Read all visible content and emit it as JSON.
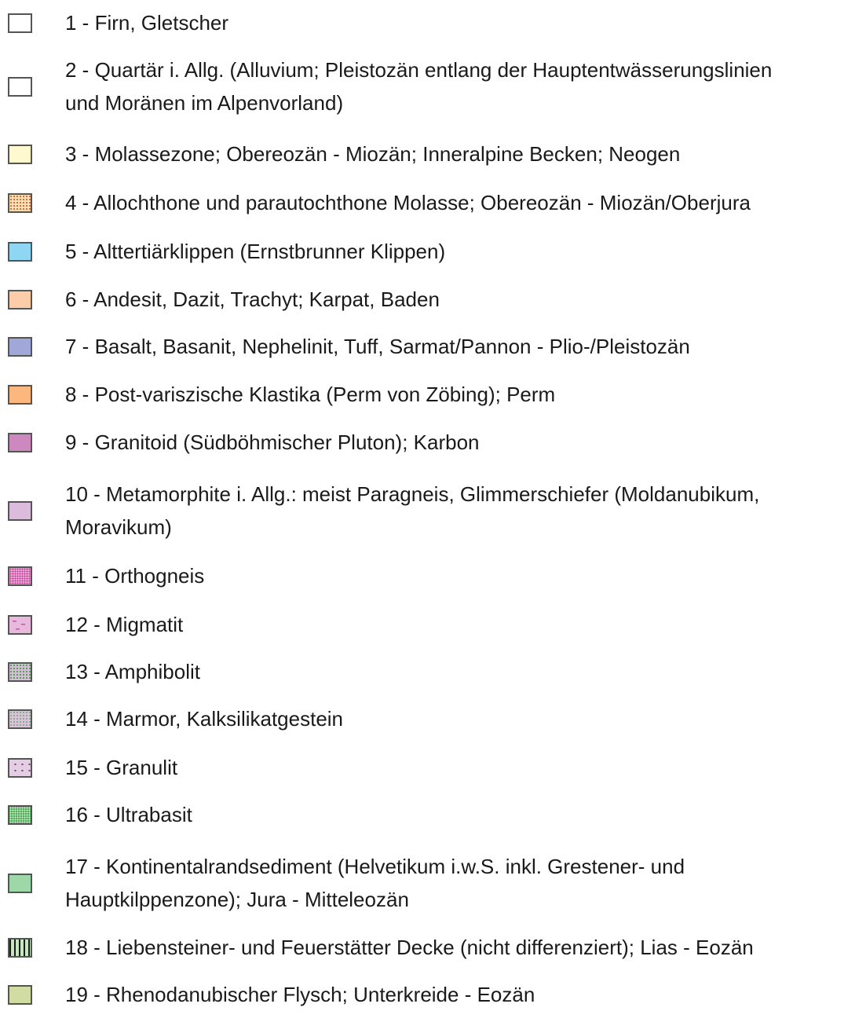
{
  "legend": {
    "items": [
      {
        "label": "1 - Firn, Gletscher",
        "label_lines": [
          "1 - Firn, Gletscher"
        ],
        "swatch": {
          "fill": "#ffffff"
        }
      },
      {
        "label": "2 - Quartär i. Allg. (Alluvium; Pleistozän entlang der Hauptentwässerungslinien und Moränen im Alpenvorland)",
        "label_lines": [
          "2 - Quartär i. Allg. (Alluvium; Pleistozän entlang der Hauptentwässerungslinien",
          "und Moränen im Alpenvorland)"
        ],
        "swatch": {
          "fill": "#ffffff"
        }
      },
      {
        "label": "3 - Molassezone; Obereozän - Miozän; Inneralpine Becken; Neogen",
        "label_lines": [
          "3 - Molassezone; Obereozän - Miozän; Inneralpine Becken; Neogen"
        ],
        "swatch": {
          "fill": "#fff9cf"
        }
      },
      {
        "label": "4 - Allochthone und parautochthone Molasse; Obereozän - Miozän/Oberjura",
        "label_lines": [
          "4 - Allochthone und parautochthone Molasse; Obereozän - Miozän/Oberjura"
        ],
        "swatch": {
          "fill": "#fbe6b0",
          "pattern": "dots",
          "pattern_color": "#e05050"
        }
      },
      {
        "label": "5 - Alttertiärklippen (Ernstbrunner Klippen)",
        "label_lines": [
          "5 - Alttertiärklippen (Ernstbrunner Klippen)"
        ],
        "swatch": {
          "fill": "#8fd6f2"
        }
      },
      {
        "label": "6 - Andesit, Dazit, Trachyt; Karpat, Baden",
        "label_lines": [
          "6 - Andesit, Dazit, Trachyt; Karpat, Baden"
        ],
        "swatch": {
          "fill": "#fdcdaa"
        }
      },
      {
        "label": "7 - Basalt, Basanit, Nephelinit, Tuff, Sarmat/Pannon - Plio-/Pleistozän",
        "label_lines": [
          "7 - Basalt, Basanit, Nephelinit, Tuff, Sarmat/Pannon - Plio-/Pleistozän"
        ],
        "swatch": {
          "fill": "#9fa8d8"
        }
      },
      {
        "label": "8 - Post-variszische Klastika (Perm von Zöbing); Perm",
        "label_lines": [
          "8 - Post-variszische Klastika (Perm von Zöbing); Perm"
        ],
        "swatch": {
          "fill": "#fbb77e"
        }
      },
      {
        "label": "9 - Granitoid (Südböhmischer Pluton); Karbon",
        "label_lines": [
          "9 - Granitoid (Südböhmischer Pluton); Karbon"
        ],
        "swatch": {
          "fill": "#cc88bf"
        }
      },
      {
        "label": "10 - Metamorphite i. Allg.: meist Paragneis, Glimmerschiefer (Moldanubikum, Moravikum)",
        "label_lines": [
          "10 - Metamorphite i. Allg.: meist Paragneis, Glimmerschiefer (Moldanubikum,",
          "Moravikum)"
        ],
        "swatch": {
          "fill": "#dcbcdc"
        }
      },
      {
        "label": "11 - Orthogneis",
        "label_lines": [
          "11 - Orthogneis"
        ],
        "swatch": {
          "fill": "#f3c4e4",
          "pattern": "dense-dots",
          "pattern_color": "#c43a9a"
        }
      },
      {
        "label": "12 - Migmatit",
        "label_lines": [
          "12 - Migmatit"
        ],
        "swatch": {
          "fill": "#e9b9dd",
          "pattern": "dashes",
          "pattern_color": "#b060a0"
        }
      },
      {
        "label": "13 - Amphibolit",
        "label_lines": [
          "13 - Amphibolit"
        ],
        "swatch": {
          "fill": "#d6bfd8",
          "pattern": "dots",
          "pattern_color": "#4a9a4a"
        }
      },
      {
        "label": "14 - Marmor, Kalksilikatgestein",
        "label_lines": [
          "14 - Marmor, Kalksilikatgestein"
        ],
        "swatch": {
          "fill": "#dcc2dc",
          "pattern": "dots",
          "pattern_color": "#7fae7f"
        }
      },
      {
        "label": "15 - Granulit",
        "label_lines": [
          "15 - Granulit"
        ],
        "swatch": {
          "fill": "#e6cde6",
          "pattern": "sparse-dots",
          "pattern_color": "#555555"
        }
      },
      {
        "label": "16 - Ultrabasit",
        "label_lines": [
          "16 - Ultrabasit"
        ],
        "swatch": {
          "fill": "#2f9a3a",
          "pattern": "dense-dots",
          "pattern_color": "#d2f0d2"
        }
      },
      {
        "label": "17 - Kontinentalrandsediment (Helvetikum i.w.S. inkl. Grestener- und Hauptkilppenzone); Jura - Mitteleozän",
        "label_lines": [
          "17 - Kontinentalrandsediment (Helvetikum i.w.S. inkl. Grestener- und",
          "Hauptkilppenzone); Jura - Mitteleozän"
        ],
        "swatch": {
          "fill": "#9fd8a8"
        }
      },
      {
        "label": "18 - Liebensteiner- und Feuerstätter Decke (nicht differenziert); Lias - Eozän",
        "label_lines": [
          "18 - Liebensteiner- und Feuerstätter Decke (nicht differenziert); Lias - Eozän"
        ],
        "swatch": {
          "fill": "#c6e6be",
          "pattern": "vertical-lines",
          "pattern_color": "#1a1a1a"
        }
      },
      {
        "label": "19 - Rhenodanubischer Flysch; Unterkreide - Eozän",
        "label_lines": [
          "19 - Rhenodanubischer Flysch; Unterkreide - Eozän"
        ],
        "swatch": {
          "fill": "#d0dca2"
        }
      }
    ]
  }
}
